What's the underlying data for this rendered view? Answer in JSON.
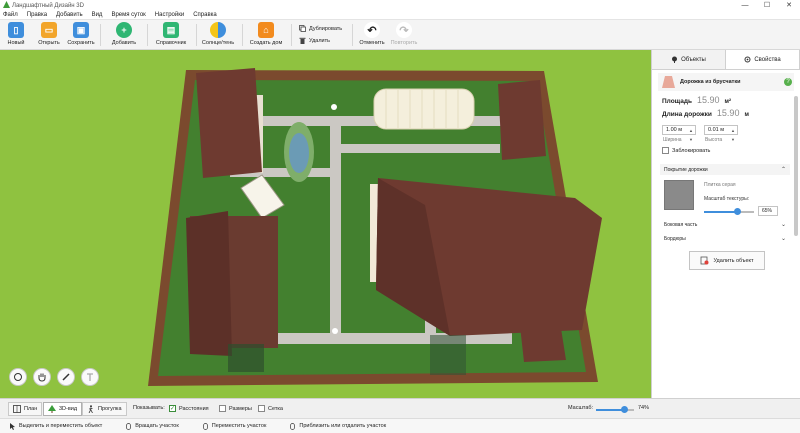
{
  "window": {
    "title": "Ландшафтный Дизайн 3D",
    "controls": [
      "—",
      "☐",
      "✕"
    ]
  },
  "menu": [
    "Файл",
    "Правка",
    "Добавить",
    "Вид",
    "Время суток",
    "Настройки",
    "Справка"
  ],
  "toolbar": {
    "new": "Новый",
    "open": "Открыть",
    "save": "Сохранить",
    "add": "Добавить",
    "reference": "Справочник",
    "sun_shade": "Солнце/тень",
    "build_house": "Создать дом",
    "duplicate": "Дублировать",
    "delete": "Удалить",
    "undo": "Отменить",
    "redo": "Повторить"
  },
  "panel": {
    "tab_objects": "Объекты",
    "tab_properties": "Свойства",
    "object_name": "Дорожка из брусчатки",
    "help": "?",
    "area_label": "Площадь",
    "area_value": "15.90",
    "area_unit": "м²",
    "length_label": "Длина дорожки",
    "length_value": "15.90",
    "length_unit": "м",
    "width_value": "1.00 м",
    "width_label": "Ширина",
    "height_value": "0.01 м",
    "height_label": "Высота",
    "lock_label": "Заблокировать",
    "coating_title": "Покрытие дорожки",
    "texture_name": "Плитка серая",
    "texture_scale_label": "Масштаб текстуры:",
    "texture_scale": "65%",
    "texture_scale_fraction": 0.65,
    "side_part": "Боковая часть",
    "borders": "Бордюры",
    "delete_object": "Удалить объект"
  },
  "views": {
    "plan": "План",
    "view3d": "3D-вид",
    "walk": "Прогулка",
    "show_label": "Показывать:",
    "distances": "Расстояния",
    "sizes": "Размеры",
    "grid": "Сетка",
    "scale_label": "Масштаб:",
    "scale_value": "74%",
    "scale_fraction": 0.74
  },
  "status": [
    "Выделить и переместить объект",
    "Вращать участок",
    "Переместить участок",
    "Приблизить или отдалить участок"
  ],
  "colors": {
    "grass": "#43802f",
    "path": "#c9c5c0",
    "roof": "#6e3a30",
    "fence": "#7b4a2e",
    "accent": "#3f8edc",
    "green_btn": "#2fb673",
    "orange_btn": "#f28b1e"
  }
}
